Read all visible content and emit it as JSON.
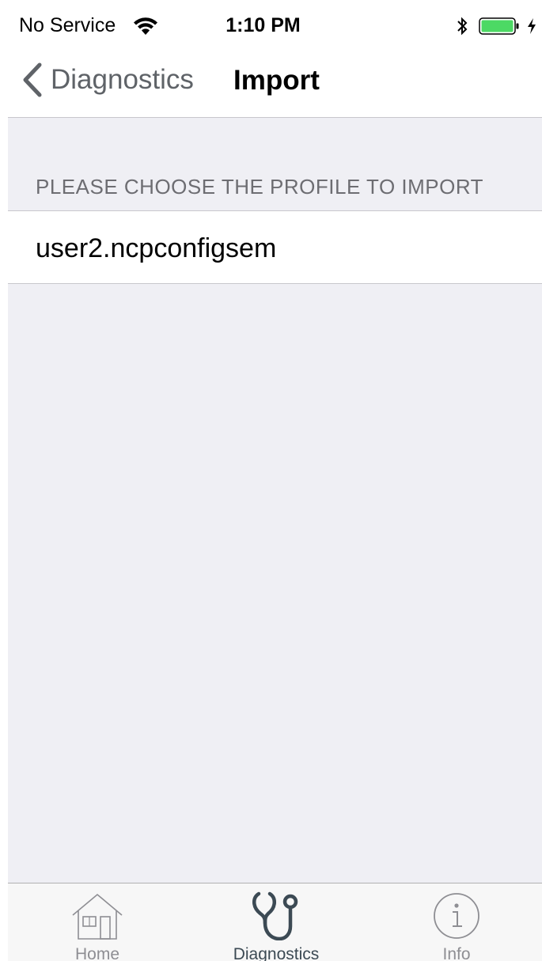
{
  "status_bar": {
    "carrier": "No Service",
    "time": "1:10 PM",
    "icons": [
      "wifi-icon",
      "bluetooth-icon",
      "battery-icon",
      "charging-icon"
    ],
    "battery_color": "#4cd964"
  },
  "nav": {
    "back_label": "Diagnostics",
    "title": "Import"
  },
  "content": {
    "section_header": "PLEASE CHOOSE THE PROFILE TO IMPORT",
    "profiles": [
      {
        "label": "user2.ncpconfigsem"
      }
    ]
  },
  "tab_bar": {
    "tabs": [
      {
        "label": "Home",
        "icon": "home-icon",
        "active": false
      },
      {
        "label": "Diagnostics",
        "icon": "stethoscope-icon",
        "active": true
      },
      {
        "label": "Info",
        "icon": "info-icon",
        "active": false
      }
    ]
  },
  "colors": {
    "background": "#efeff4",
    "accent": "#3c4a54",
    "inactive": "#8e8e93"
  }
}
